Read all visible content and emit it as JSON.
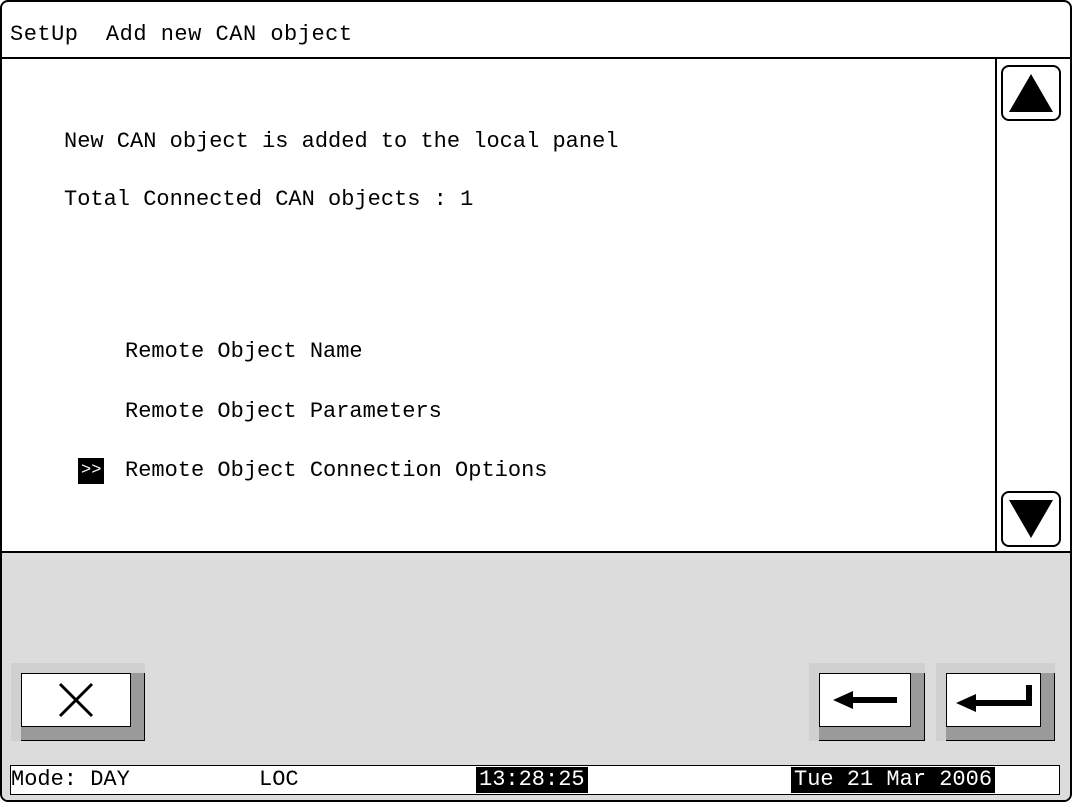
{
  "window": {
    "title_section": "SetUp",
    "title_text": "Add new CAN object"
  },
  "content": {
    "message": "New CAN object is added to the local panel",
    "total_label": "Total Connected CAN objects : 1",
    "menu_items": [
      {
        "label": "Remote Object Name",
        "selected": false
      },
      {
        "label": "Remote Object Parameters",
        "selected": false
      },
      {
        "label": "Remote Object Connection Options",
        "selected": true
      }
    ],
    "selection_marker": ">>"
  },
  "scrollbar": {
    "up_icon": "triangle-up-icon",
    "down_icon": "triangle-down-icon"
  },
  "buttons": {
    "cancel_icon": "close-icon",
    "back_icon": "arrow-left-icon",
    "enter_icon": "enter-icon"
  },
  "status": {
    "mode": "Mode: DAY",
    "location": "LOC",
    "time": "13:28:25",
    "date": "Tue 21 Mar 2006"
  },
  "colors": {
    "background": "#ffffff",
    "panel_gray": "#dcdcdc",
    "button_shade": "#9a9a9a",
    "highlight": "#000000"
  }
}
